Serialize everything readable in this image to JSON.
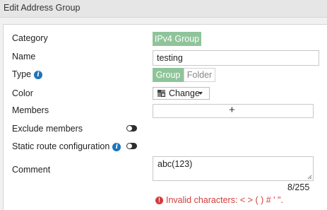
{
  "header": {
    "title": "Edit Address Group"
  },
  "form": {
    "category_label": "Category",
    "category_value": "IPv4 Group",
    "name_label": "Name",
    "name_value": "testing",
    "type_label": "Type",
    "type_options": [
      "Group",
      "Folder"
    ],
    "type_selected": "Group",
    "color_label": "Color",
    "change_label": "Change",
    "members_label": "Members",
    "members_add_symbol": "+",
    "exclude_members_label": "Exclude members",
    "exclude_members_enabled": false,
    "static_route_label": "Static route configuration",
    "static_route_enabled": false,
    "comment_label": "Comment",
    "comment_value": "abc(123)",
    "comment_counter": "8/255",
    "error_text": "Invalid characters: < > ( ) # ' \"."
  },
  "icons": {
    "info": "info-icon",
    "color_swatch": "color-swatch-icon",
    "dropdown": "caret-down-icon",
    "error": "exclamation-circle-icon"
  },
  "colors": {
    "accent_green": "#8fc49a",
    "error_red": "#d23c3c",
    "info_blue": "#1f74b8"
  }
}
